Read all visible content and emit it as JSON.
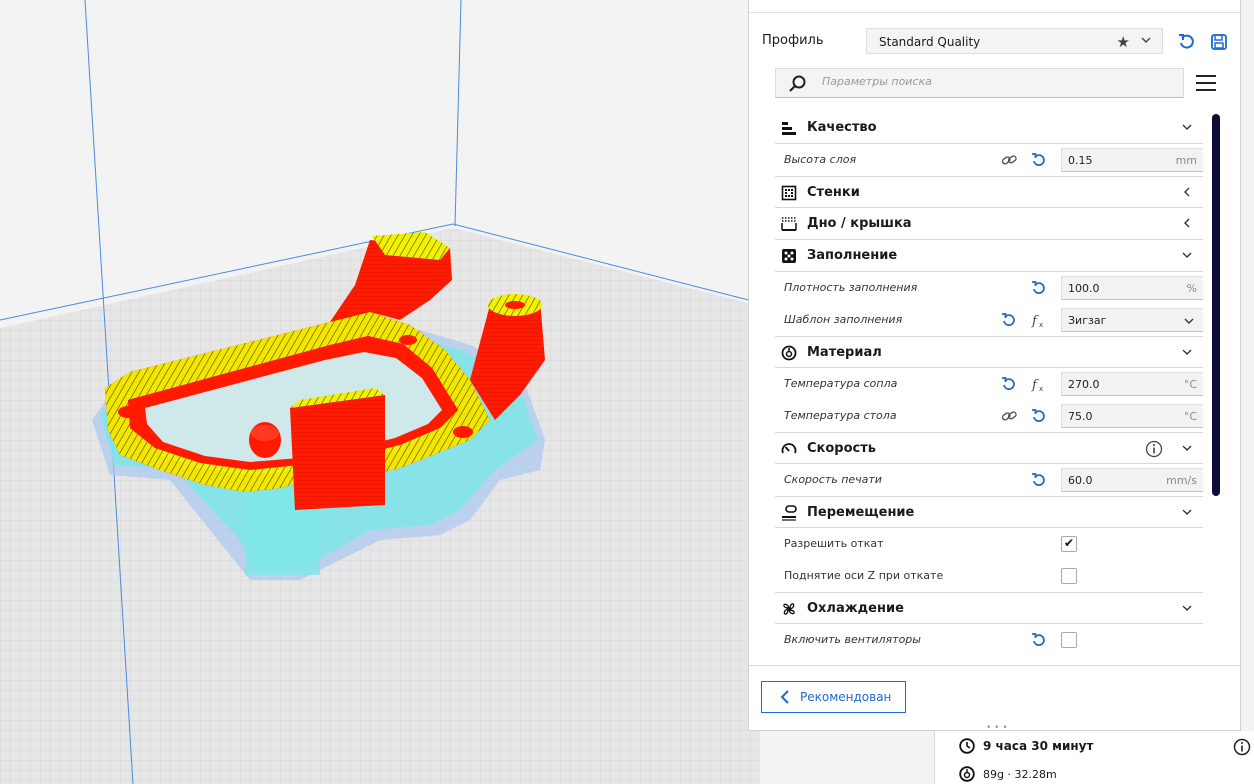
{
  "profile": {
    "label": "Профиль",
    "value": "Standard Quality",
    "star_icon": "star-icon",
    "chevron_icon": "chevron-down-icon",
    "reset_icon": "reset-icon",
    "save_icon": "save-icon"
  },
  "search": {
    "placeholder": "Параметры поиска",
    "icon": "search-icon",
    "menu_icon": "hamburger-icon"
  },
  "sections": {
    "quality": {
      "label": "Качество",
      "layer_height": {
        "label": "Высота слоя",
        "value": "0.15",
        "unit": "mm"
      }
    },
    "walls": {
      "label": "Стенки"
    },
    "bottom_top": {
      "label": "Дно / крышка"
    },
    "infill": {
      "label": "Заполнение",
      "density": {
        "label": "Плотность заполнения",
        "value": "100.0",
        "unit": "%"
      },
      "pattern": {
        "label": "Шаблон заполнения",
        "value": "Зигзаг"
      }
    },
    "material": {
      "label": "Материал",
      "nozzle_temp": {
        "label": "Температура сопла",
        "value": "270.0",
        "unit": "°C"
      },
      "bed_temp": {
        "label": "Температура стола",
        "value": "75.0",
        "unit": "°C"
      }
    },
    "speed": {
      "label": "Скорость",
      "print_speed": {
        "label": "Скорость печати",
        "value": "60.0",
        "unit": "mm/s"
      }
    },
    "travel": {
      "label": "Перемещение",
      "retraction": {
        "label": "Разрешить откат",
        "checked": true
      },
      "z_hop": {
        "label": "Поднятие оси Z при откате",
        "checked": false
      }
    },
    "cooling": {
      "label": "Охлаждение",
      "fans": {
        "label": "Включить вентиляторы",
        "checked": false
      }
    }
  },
  "recommended_button": {
    "label": "Рекомендован"
  },
  "print_info": {
    "time": "9 часа 30 минут",
    "material": "89g · 32.28m"
  },
  "colors": {
    "accent": "#1e6ad0",
    "model_red": "#ff1a00",
    "model_yellow": "#f2f200",
    "support_cyan": "#7fe6e6",
    "bed_grid": "#e4e4e4",
    "scrollbar": "#0c0c3c"
  }
}
